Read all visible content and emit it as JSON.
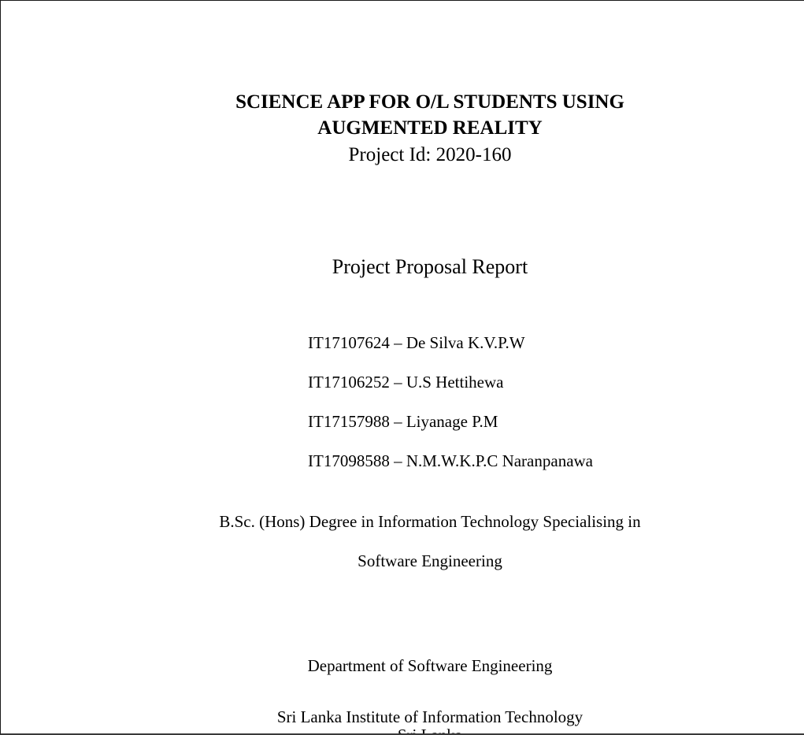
{
  "document": {
    "title_line1": "SCIENCE APP FOR O/L STUDENTS USING",
    "title_line2": "AUGMENTED REALITY",
    "project_id": "Project Id: 2020-160",
    "report_type": "Project Proposal Report",
    "members": [
      "IT17107624 – De Silva K.V.P.W",
      "IT17106252 – U.S Hettihewa",
      "IT17157988 – Liyanage P.M",
      "IT17098588 – N.M.W.K.P.C Naranpanawa"
    ],
    "degree_line1": "B.Sc. (Hons) Degree in Information Technology Specialising in",
    "degree_line2": "Software Engineering",
    "department": "Department of Software Engineering",
    "institute": "Sri Lanka Institute of Information Technology",
    "country": "Sri Lanka"
  }
}
